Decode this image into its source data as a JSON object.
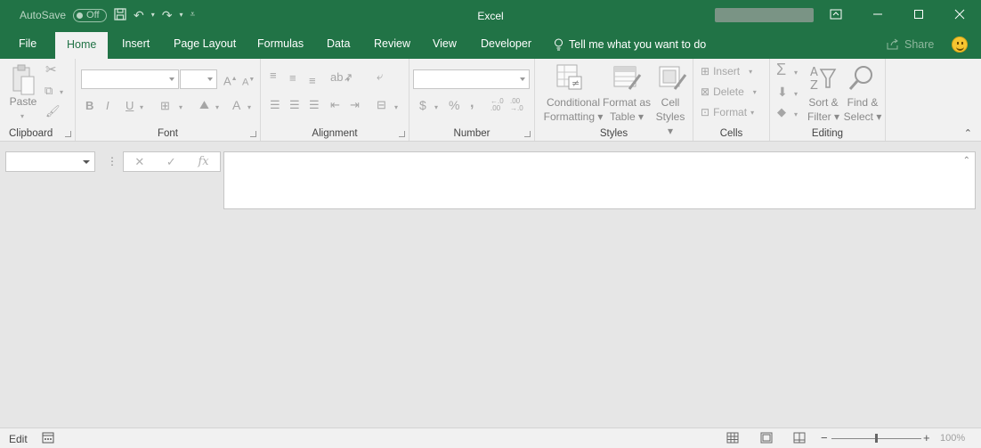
{
  "titlebar": {
    "autosave_label": "AutoSave",
    "autosave_state": "Off",
    "app_title": "Excel",
    "restore_icon": "ribbon-display-icon",
    "minimize_icon": "minimize-icon",
    "maximize_icon": "maximize-icon",
    "close_icon": "close-icon"
  },
  "tabs": [
    {
      "label": "File"
    },
    {
      "label": "Home"
    },
    {
      "label": "Insert"
    },
    {
      "label": "Page Layout"
    },
    {
      "label": "Formulas"
    },
    {
      "label": "Data"
    },
    {
      "label": "Review"
    },
    {
      "label": "View"
    },
    {
      "label": "Developer"
    }
  ],
  "tell_me": "Tell me what you want to do",
  "share": "Share",
  "ribbon": {
    "clipboard": {
      "label": "Clipboard",
      "paste": "Paste"
    },
    "font": {
      "label": "Font",
      "bold": "B",
      "italic": "I",
      "underline": "U",
      "font_color": "A"
    },
    "alignment": {
      "label": "Alignment"
    },
    "number": {
      "label": "Number",
      "currency": "$",
      "percent": "%",
      "comma": ","
    },
    "styles": {
      "label": "Styles",
      "conditional_1": "Conditional",
      "conditional_2": "Formatting",
      "format_as_1": "Format as",
      "format_as_2": "Table",
      "cell_1": "Cell",
      "cell_2": "Styles"
    },
    "cells": {
      "label": "Cells",
      "insert": "Insert",
      "delete": "Delete",
      "format": "Format"
    },
    "editing": {
      "label": "Editing",
      "sort_1": "Sort &",
      "sort_2": "Filter",
      "find_1": "Find &",
      "find_2": "Select"
    }
  },
  "formula_bar": {
    "fx": "fx"
  },
  "status": {
    "mode": "Edit",
    "zoom": "100%"
  }
}
